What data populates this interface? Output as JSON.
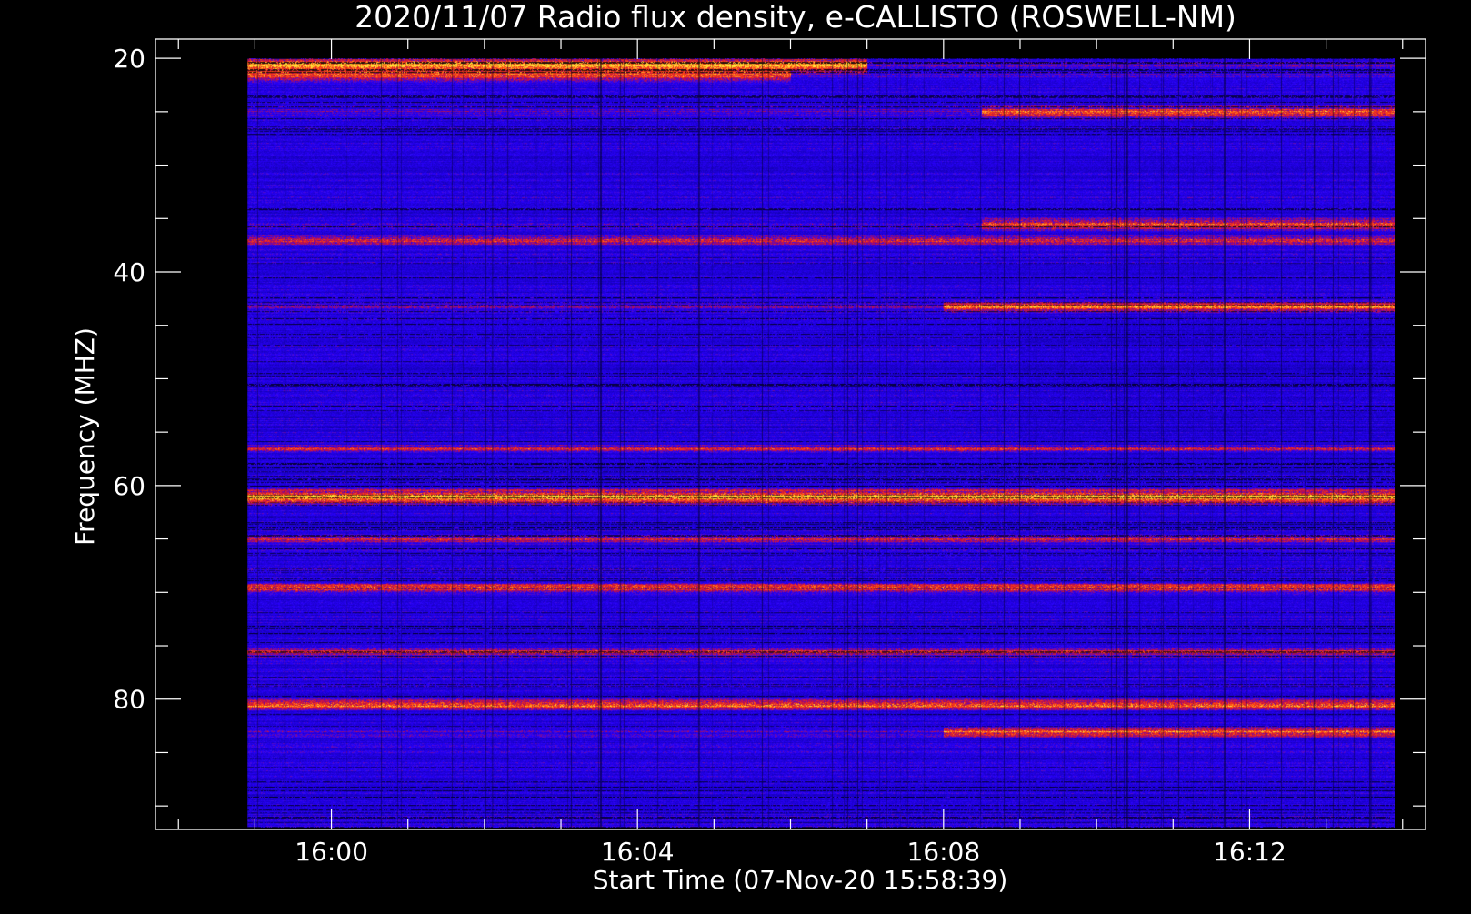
{
  "chart_data": {
    "type": "heatmap",
    "title": "2020/11/07  Radio flux density, e-CALLISTO (ROSWELL-NM)",
    "xlabel": "Start Time (07-Nov-20 15:58:39)",
    "ylabel": "Frequency (MHZ)",
    "x_start_label": "15:58:39",
    "x_ticks": [
      "16:00",
      "16:04",
      "16:08",
      "16:12"
    ],
    "y_ticks": [
      "20",
      "40",
      "60",
      "80"
    ],
    "xlim_minutes": [
      -2.3,
      14.3
    ],
    "data_extent_minutes": [
      -1.1,
      13.9
    ],
    "ylim_mhz": [
      18.2,
      92.2
    ],
    "data_extent_mhz": [
      20,
      92
    ],
    "y_inverted": true,
    "grid": false,
    "colormap": [
      "#000000",
      "#1a00c8",
      "#2e10ff",
      "#b01828",
      "#ff3010",
      "#ffe040"
    ],
    "bands": [
      {
        "freq": 20.6,
        "width": 0.6,
        "intensity": 0.95,
        "fade_at_minute": 7.0
      },
      {
        "freq": 21.6,
        "width": 0.5,
        "intensity": 0.6,
        "fade_at_minute": 6.0
      },
      {
        "freq": 37.0,
        "width": 0.4,
        "intensity": 0.6
      },
      {
        "freq": 43.2,
        "width": 0.4,
        "intensity": 0.8,
        "start_at_minute": 8.0
      },
      {
        "freq": 56.5,
        "width": 0.3,
        "intensity": 0.55
      },
      {
        "freq": 61.0,
        "width": 0.6,
        "intensity": 0.95
      },
      {
        "freq": 65.0,
        "width": 0.3,
        "intensity": 0.5
      },
      {
        "freq": 69.5,
        "width": 0.4,
        "intensity": 0.75
      },
      {
        "freq": 75.5,
        "width": 0.4,
        "intensity": 0.55
      },
      {
        "freq": 80.5,
        "width": 0.4,
        "intensity": 0.8
      },
      {
        "freq": 83.0,
        "width": 0.4,
        "intensity": 0.75,
        "start_at_minute": 8.0
      },
      {
        "freq": 35.5,
        "width": 0.5,
        "intensity": 0.7,
        "start_at_minute": 8.5
      },
      {
        "freq": 25.0,
        "width": 0.5,
        "intensity": 0.7,
        "start_at_minute": 8.5
      }
    ]
  }
}
